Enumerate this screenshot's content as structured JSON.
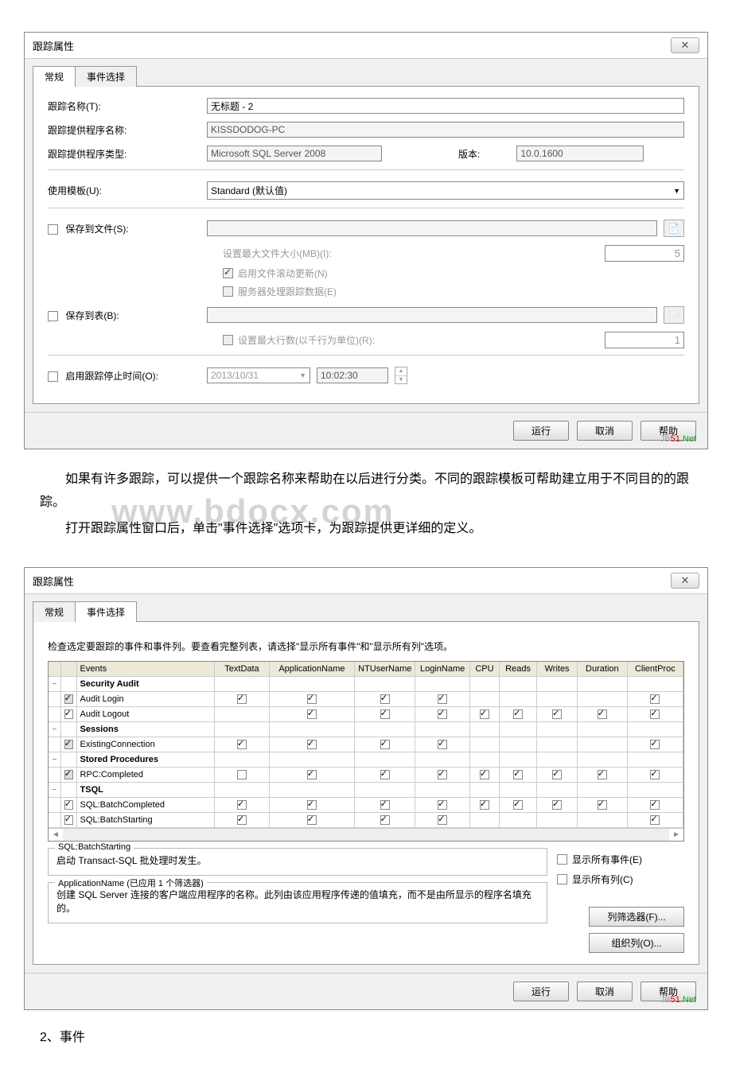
{
  "dialog1": {
    "title": "跟踪属性",
    "close_icon": "✕",
    "tabs": {
      "general": "常规",
      "events": "事件选择"
    },
    "rows": {
      "trace_name_label": "跟踪名称(T):",
      "trace_name_value": "无标题 - 2",
      "provider_name_label": "跟踪提供程序名称:",
      "provider_name_value": "KISSDODOG-PC",
      "provider_type_label": "跟踪提供程序类型:",
      "provider_type_value": "Microsoft SQL Server 2008",
      "version_label": "版本:",
      "version_value": "10.0.1600",
      "template_label": "使用模板(U):",
      "template_value": "Standard (默认值)",
      "save_file_label": "保存到文件(S):",
      "max_file_label": "设置最大文件大小(MB)(I):",
      "max_file_value": "5",
      "rollover_label": "启用文件滚动更新(N)",
      "server_proc_label": "服务器处理跟踪数据(E)",
      "save_table_label": "保存到表(B):",
      "max_rows_label": "设置最大行数(以千行为单位)(R):",
      "max_rows_value": "1",
      "stop_time_label": "启用跟踪停止时间(O):",
      "stop_date": "2013/10/31",
      "stop_time": "10:02:30"
    },
    "buttons": {
      "run": "运行",
      "cancel": "取消",
      "help": "帮助"
    },
    "logo": {
      "prefix": "JB",
      "suffix": "51.",
      "net": "Net"
    }
  },
  "article": {
    "p1": "如果有许多跟踪，可以提供一个跟踪名称来帮助在以后进行分类。不同的跟踪模板可帮助建立用于不同目的的跟踪。",
    "p2": "打开跟踪属性窗口后，单击\"事件选择\"选项卡，为跟踪提供更详细的定义。",
    "watermark": "www.bdocx.com"
  },
  "dialog2": {
    "title": "跟踪属性",
    "tabs": {
      "general": "常规",
      "events": "事件选择"
    },
    "hint": "检查选定要跟踪的事件和事件列。要查看完整列表，请选择\"显示所有事件\"和\"显示所有列\"选项。",
    "header": {
      "events": "Events",
      "textdata": "TextData",
      "appname": "ApplicationName",
      "ntuser": "NTUserName",
      "login": "LoginName",
      "cpu": "CPU",
      "reads": "Reads",
      "writes": "Writes",
      "duration": "Duration",
      "clientproc": "ClientProc"
    },
    "groups_rows": [
      {
        "type": "group",
        "name": "Security Audit"
      },
      {
        "type": "event",
        "name": "Audit Login",
        "chk": "gray",
        "td": true,
        "app": true,
        "nt": true,
        "ln": true,
        "cpu": null,
        "rd": null,
        "wr": null,
        "dur": null,
        "cp": true
      },
      {
        "type": "event",
        "name": "Audit Logout",
        "chk": "checked",
        "td": null,
        "app": true,
        "nt": true,
        "ln": true,
        "cpu": true,
        "rd": true,
        "wr": true,
        "dur": true,
        "cp": true
      },
      {
        "type": "group",
        "name": "Sessions"
      },
      {
        "type": "event",
        "name": "ExistingConnection",
        "chk": "gray",
        "td": true,
        "app": true,
        "nt": true,
        "ln": true,
        "cpu": null,
        "rd": null,
        "wr": null,
        "dur": null,
        "cp": true
      },
      {
        "type": "group",
        "name": "Stored Procedures"
      },
      {
        "type": "event",
        "name": "RPC:Completed",
        "chk": "gray",
        "td": false,
        "app": true,
        "nt": true,
        "ln": true,
        "cpu": true,
        "rd": true,
        "wr": true,
        "dur": true,
        "cp": true
      },
      {
        "type": "group",
        "name": "TSQL"
      },
      {
        "type": "event",
        "name": "SQL:BatchCompleted",
        "chk": "checked",
        "td": true,
        "app": true,
        "nt": true,
        "ln": true,
        "cpu": true,
        "rd": true,
        "wr": true,
        "dur": true,
        "cp": true
      },
      {
        "type": "event",
        "name": "SQL:BatchStarting",
        "chk": "checked",
        "td": true,
        "app": true,
        "nt": true,
        "ln": true,
        "cpu": null,
        "rd": null,
        "wr": null,
        "dur": null,
        "cp": true
      }
    ],
    "desc1": {
      "legend": "SQL:BatchStarting",
      "text": "启动 Transact-SQL 批处理时发生。"
    },
    "desc2": {
      "legend": "ApplicationName (已应用 1 个筛选器)",
      "text": "创建 SQL Server 连接的客户端应用程序的名称。此列由该应用程序传递的值填充，而不是由所显示的程序名填充的。"
    },
    "options": {
      "show_all_events": "显示所有事件(E)",
      "show_all_cols": "显示所有列(C)",
      "col_filter": "列筛选器(F)...",
      "org_cols": "组织列(O)..."
    },
    "buttons": {
      "run": "运行",
      "cancel": "取消",
      "help": "帮助"
    }
  },
  "section2": "2、事件"
}
